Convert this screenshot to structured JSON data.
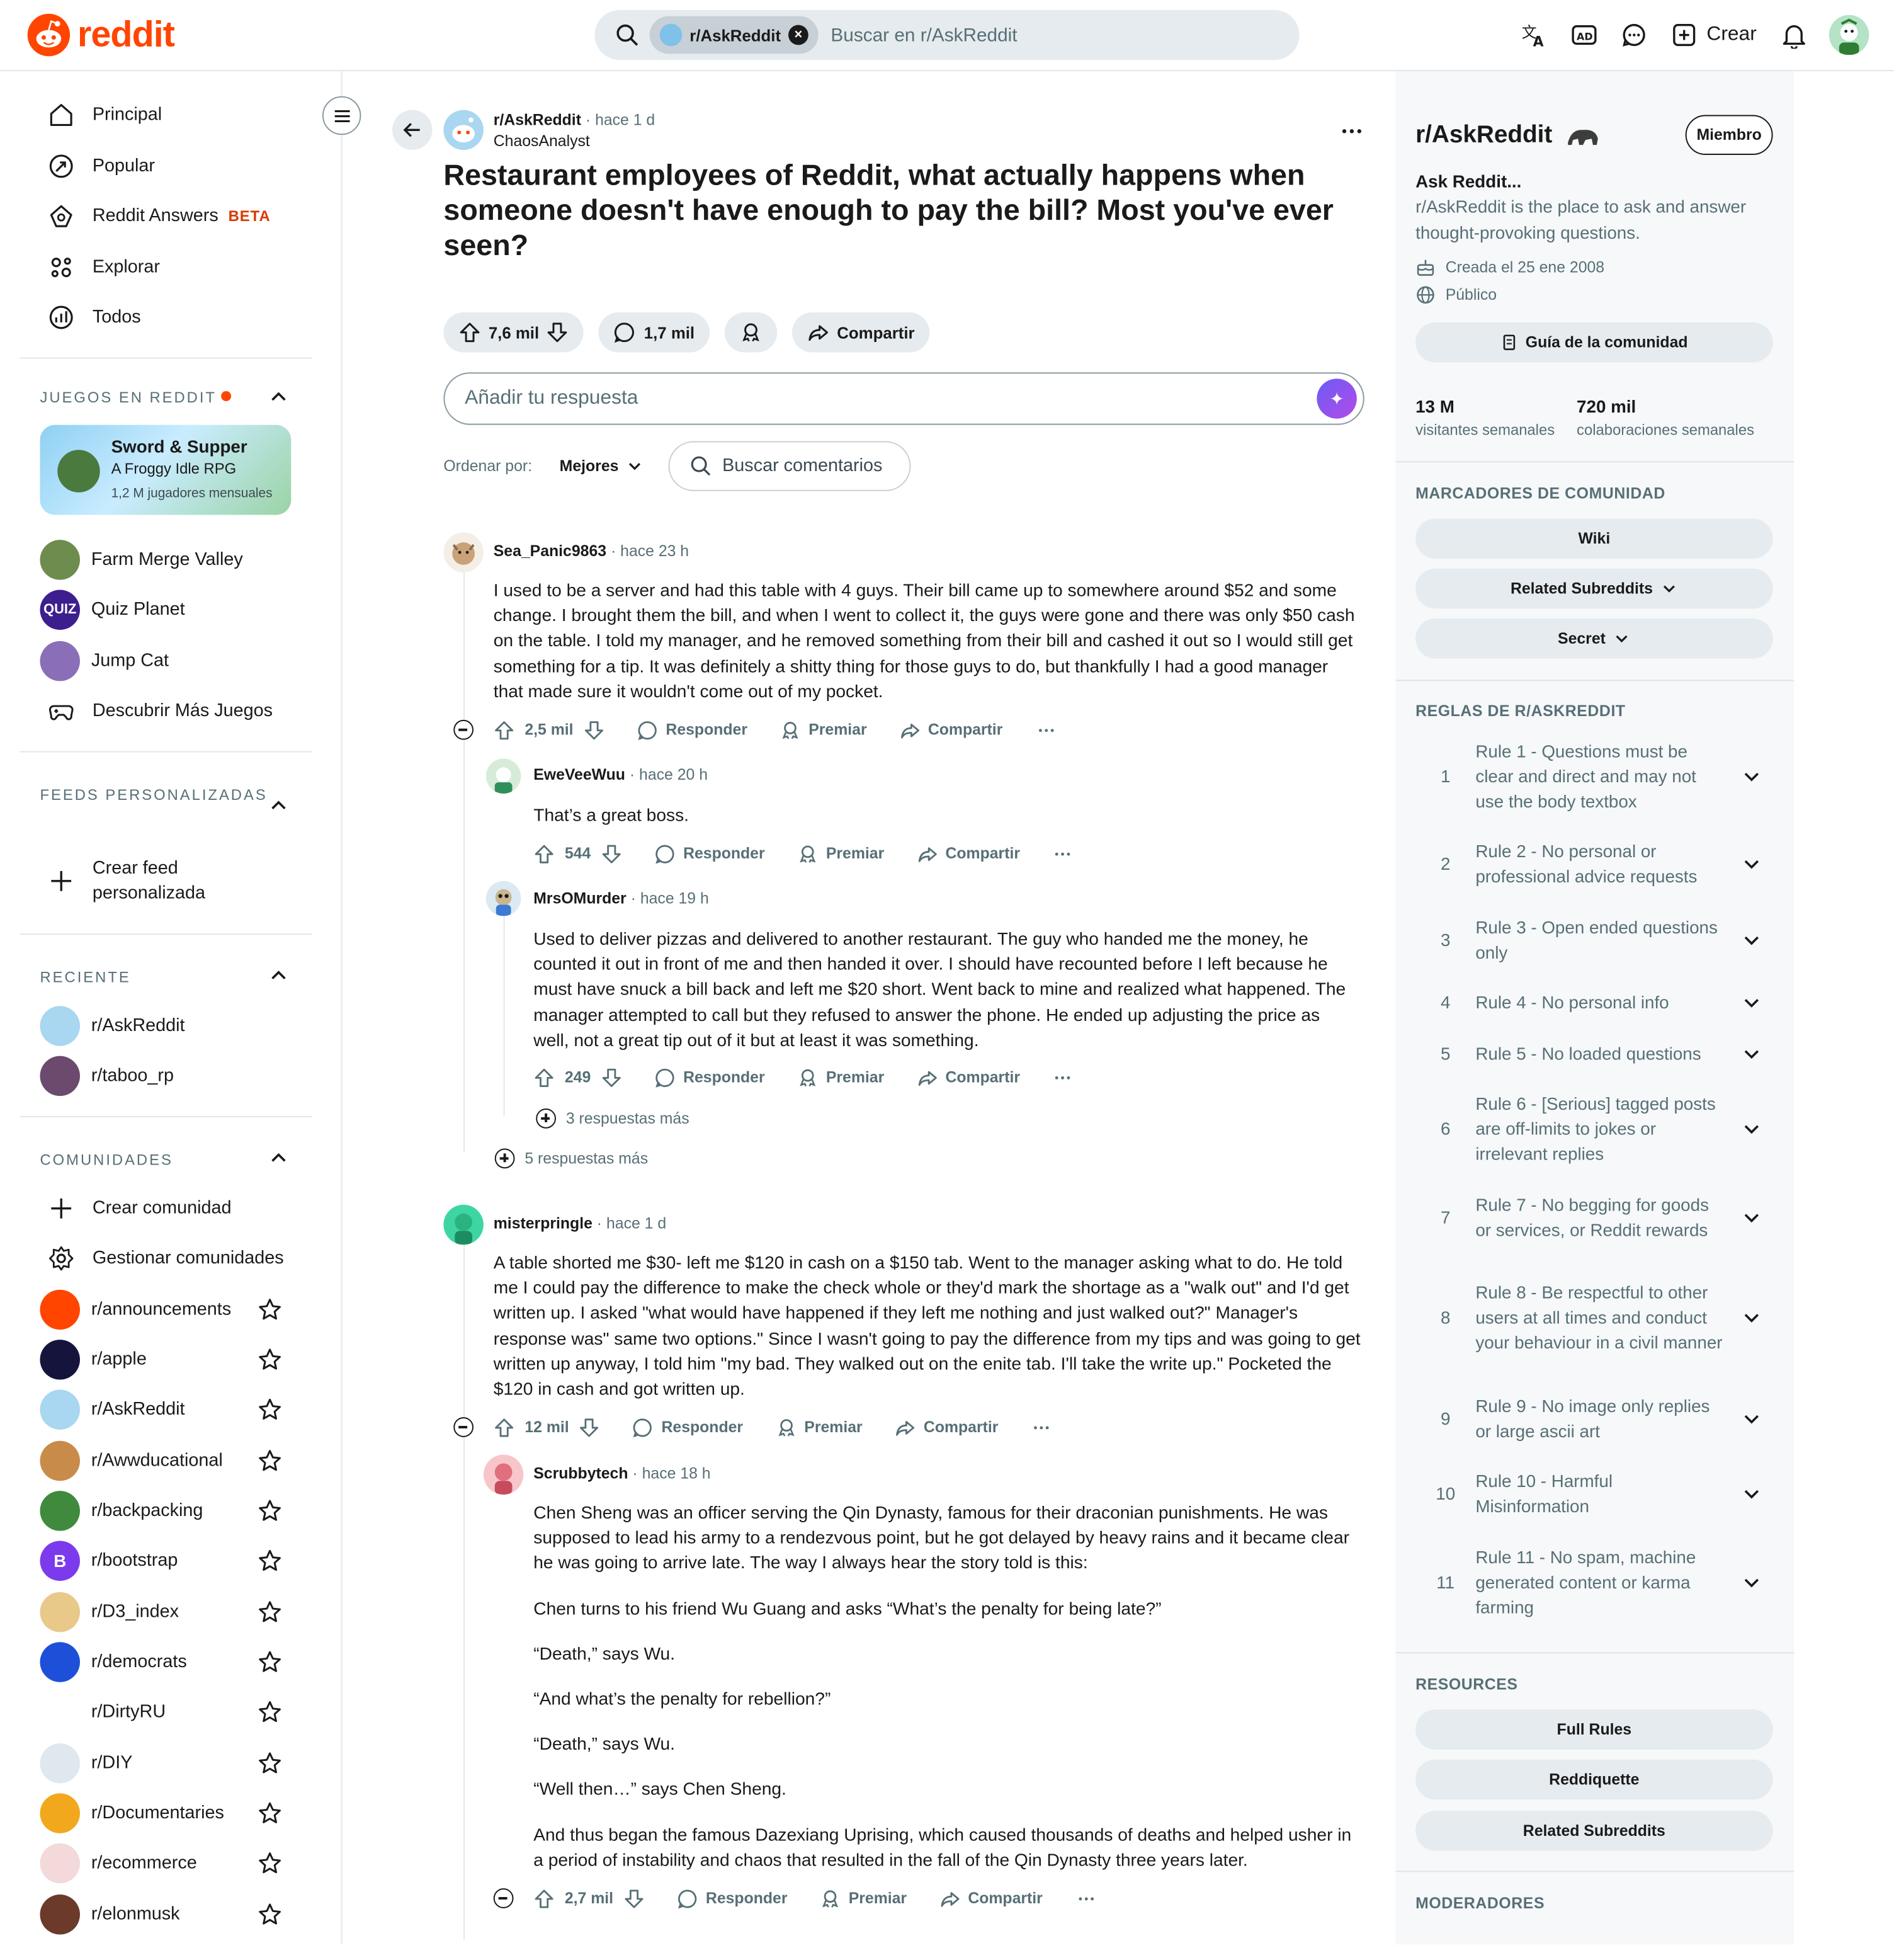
{
  "header": {
    "logo_text": "reddit",
    "search_chip": "r/AskReddit",
    "search_placeholder": "Buscar en r/AskReddit",
    "create_label": "Crear",
    "icons": [
      "translate-icon",
      "advertise-icon",
      "chat-icon",
      "create-icon",
      "bell-icon"
    ]
  },
  "nav": {
    "items": [
      {
        "label": "Principal",
        "icon": "home-icon"
      },
      {
        "label": "Popular",
        "icon": "popular-icon"
      },
      {
        "label": "Reddit Answers",
        "icon": "answers-icon",
        "badge": "BETA"
      },
      {
        "label": "Explorar",
        "icon": "explore-icon"
      },
      {
        "label": "Todos",
        "icon": "all-icon"
      }
    ]
  },
  "games": {
    "header": "JUEGOS EN REDDIT",
    "featured": {
      "title": "Sword & Supper",
      "subtitle": "A Froggy Idle RPG",
      "meta": "1,2 M jugadores mensuales"
    },
    "items": [
      "Farm Merge Valley",
      "Quiz Planet",
      "Jump Cat"
    ],
    "discover": "Descubrir Más Juegos"
  },
  "feeds": {
    "header": "FEEDS PERSONALIZADAS",
    "create": "Crear feed personalizada"
  },
  "recent": {
    "header": "RECIENTE",
    "items": [
      "r/AskReddit",
      "r/taboo_rp"
    ]
  },
  "communities": {
    "header": "COMUNIDADES",
    "create": "Crear comunidad",
    "manage": "Gestionar comunidades",
    "items": [
      "r/announcements",
      "r/apple",
      "r/AskReddit",
      "r/Awwducational",
      "r/backpacking",
      "r/bootstrap",
      "r/D3_index",
      "r/democrats",
      "r/DirtyRU",
      "r/DIY",
      "r/Documentaries",
      "r/ecommerce",
      "r/elonmusk"
    ]
  },
  "post": {
    "subreddit": "r/AskReddit",
    "time": "hace 1 d",
    "author": "ChaosAnalyst",
    "title": "Restaurant employees of Reddit, what actually happens when someone doesn't have enough to pay the bill? Most you've ever seen?",
    "votes": "7,6 mil",
    "comments": "1,7 mil",
    "share": "Compartir",
    "reply_placeholder": "Añadir tu respuesta",
    "sort_label": "Ordenar por:",
    "sort_value": "Mejores",
    "search_comments": "Buscar comentarios"
  },
  "labels": {
    "reply": "Responder",
    "award": "Premiar",
    "share": "Compartir",
    "sep": "·"
  },
  "comments": [
    {
      "author": "Sea_Panic9863",
      "time": "hace 23 h",
      "votes": "2,5 mil",
      "body": [
        "I used to be a server and had this table with 4 guys. Their bill came up to somewhere around $52 and some change. I brought them the bill, and when I went to collect it, the guys were gone and there was only $50 cash on the table. I told my manager, and he removed something from their bill and cashed it out so I would still get something for a tip. It was definitely a shitty thing for those guys to do, but thankfully I had a good manager that made sure it wouldn't come out of my pocket."
      ],
      "more": "5 respuestas más"
    },
    {
      "author": "EweVeeWuu",
      "time": "hace 20 h",
      "votes": "544",
      "body": [
        "That’s a great boss."
      ]
    },
    {
      "author": "MrsOMurder",
      "time": "hace 19 h",
      "votes": "249",
      "body": [
        "Used to deliver pizzas and delivered to another restaurant. The guy who handed me the money, he counted it out in front of me and then handed it over. I should have recounted before I left because he must have snuck a bill back and left me $20 short. Went back to mine and realized what happened. The manager attempted to call but they refused to answer the phone. He ended up adjusting the price as well, not a great tip out of it but at least it was something."
      ],
      "more": "3 respuestas más"
    },
    {
      "author": "misterpringle",
      "time": "hace 1 d",
      "votes": "12 mil",
      "body": [
        "A table shorted me $30- left me $120 in cash on a $150 tab. Went to the manager asking what to do. He told me I could pay the difference to make the check whole or they'd mark the shortage as a \"walk out\" and I'd get written up. I asked \"what would have happened if they left me nothing and just walked out?\" Manager's response was\" same two options.\" Since I wasn't going to pay the difference from my tips and was going to get written up anyway, I told him \"my bad. They walked out on the enite tab. I'll take the write up.\" Pocketed the $120 in cash and got written up."
      ]
    },
    {
      "author": "Scrubbytech",
      "time": "hace 18 h",
      "votes": "2,7 mil",
      "body": [
        "Chen Sheng was an officer serving the Qin Dynasty, famous for their draconian punishments. He was supposed to lead his army to a rendezvous point, but he got delayed by heavy rains and it became clear he was going to arrive late. The way I always hear the story told is this:",
        "Chen turns to his friend Wu Guang and asks “What’s the penalty for being late?”",
        "“Death,” says Wu.",
        "“And what’s the penalty for rebellion?”",
        "“Death,” says Wu.",
        "“Well then…” says Chen Sheng.",
        "And thus began the famous Dazexiang Uprising, which caused thousands of deaths and helped usher in a period of instability and chaos that resulted in the fall of the Qin Dynasty three years later."
      ]
    }
  ],
  "sidebar": {
    "name": "r/AskReddit",
    "member_label": "Miembro",
    "headline": "Ask Reddit...",
    "description": "r/AskReddit is the place to ask and answer thought-provoking questions.",
    "created": "Creada el 25 ene 2008",
    "visibility": "Público",
    "guide": "Guía de la comunidad",
    "visitors": "13 M",
    "visitors_label": "visitantes semanales",
    "contributions": "720 mil",
    "contributions_label": "colaboraciones semanales",
    "bookmarks_header": "MARCADORES DE COMUNIDAD",
    "bookmarks": [
      "Wiki",
      "Related Subreddits",
      "Secret"
    ],
    "rules_header": "REGLAS DE R/ASKREDDIT",
    "rules": [
      "Rule 1 - Questions must be clear and direct and may not use the body textbox",
      "Rule 2 - No personal or professional advice requests",
      "Rule 3 - Open ended questions only",
      "Rule 4 - No personal info",
      "Rule 5 - No loaded questions",
      "Rule 6 - [Serious] tagged posts are off-limits to jokes or irrelevant replies",
      "Rule 7 - No begging for goods or services, or Reddit rewards",
      "Rule 8 - Be respectful to other users at all times and conduct your behaviour in a civil manner",
      "Rule 9 - No image only replies or large ascii art",
      "Rule 10 - Harmful Misinformation",
      "Rule 11 - No spam, machine generated content or karma farming"
    ],
    "resources_header": "RESOURCES",
    "resources": [
      "Full Rules",
      "Reddiquette",
      "Related Subreddits"
    ],
    "moderators_header": "MODERADORES"
  },
  "colors": {
    "brand": "#ff4500",
    "text": "#1a1a1b",
    "muted": "#576f76",
    "pill": "#e5ebee"
  }
}
